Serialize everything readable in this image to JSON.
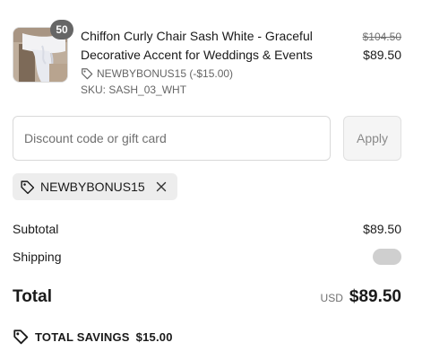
{
  "line_item": {
    "quantity_badge": "50",
    "title": "Chiffon Curly Chair Sash White - Graceful Decorative Accent for Weddings & Events",
    "discount_text": "NEWBYBONUS15 (-$15.00)",
    "sku": "SKU: SASH_03_WHT",
    "original_price": "$104.50",
    "final_price": "$89.50",
    "thumbnail_icon": "product-thumbnail-image"
  },
  "discount": {
    "placeholder": "Discount code or gift card",
    "value": "",
    "apply_label": "Apply"
  },
  "applied_code": {
    "label": "NEWBYBONUS15",
    "tag_icon": "tag-icon",
    "remove_icon": "close-icon"
  },
  "summary": {
    "subtotal_label": "Subtotal",
    "subtotal_value": "$89.50",
    "shipping_label": "Shipping",
    "total_label": "Total",
    "currency": "USD",
    "total_value": "$89.50"
  },
  "savings": {
    "label": "TOTAL SAVINGS",
    "value": "$15.00",
    "icon": "tag-icon"
  },
  "colors": {
    "text": "#1a1a1a",
    "muted": "#666666",
    "badge": "#666666",
    "chip_bg": "#ededed",
    "placeholder_pill": "#cfcfcf"
  }
}
